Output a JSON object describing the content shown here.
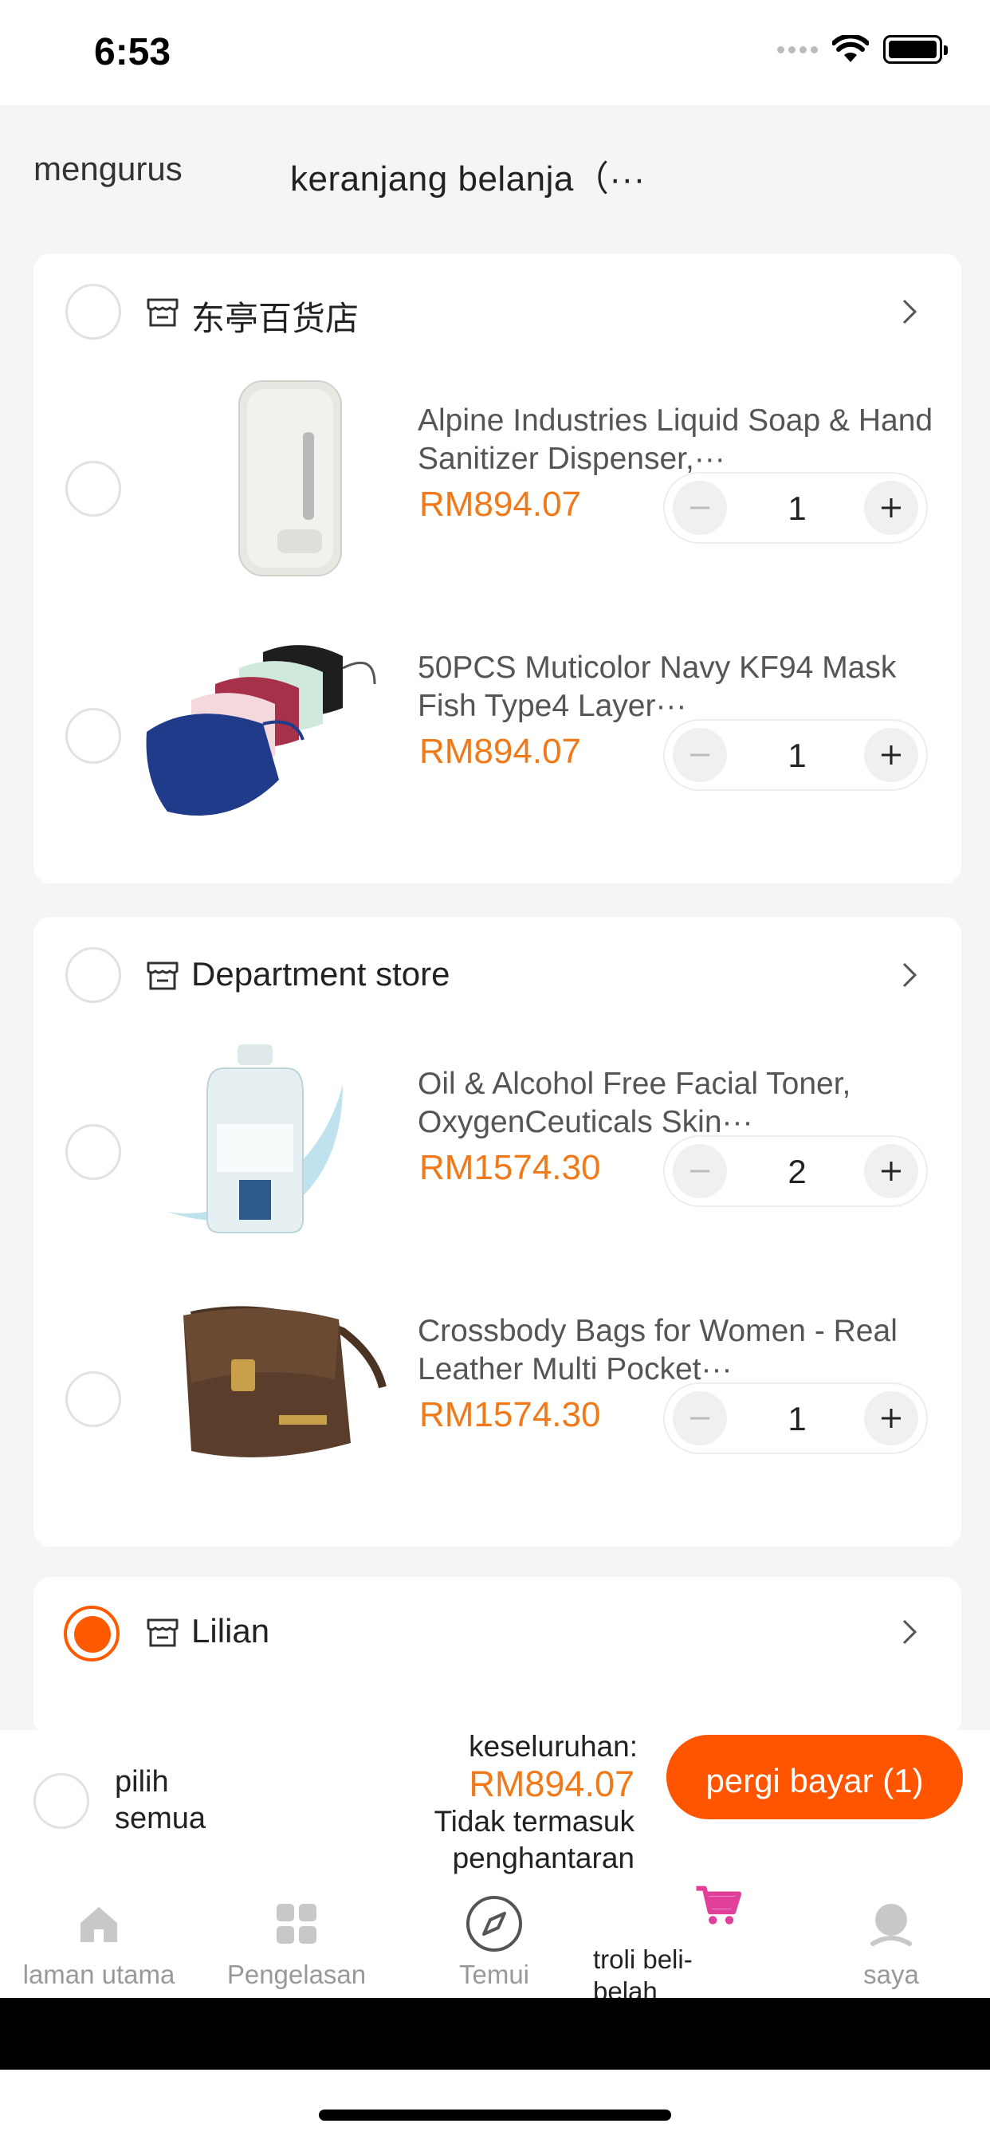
{
  "status_bar": {
    "time": "6:53"
  },
  "header": {
    "manage_label": "mengurus",
    "title": "keranjang belanja（···"
  },
  "stores": [
    {
      "name": "东亭百货店",
      "selected": false,
      "products": [
        {
          "title": "Alpine Industries Liquid Soap & Hand Sanitizer Dispenser,···",
          "price": "RM894.07",
          "quantity": "1",
          "image": "soap-dispenser"
        },
        {
          "title": "50PCS Muticolor Navy KF94 Mask Fish Type4 Layer···",
          "price": "RM894.07",
          "quantity": "1",
          "image": "face-masks"
        }
      ]
    },
    {
      "name": "Department store",
      "selected": false,
      "products": [
        {
          "title": "Oil & Alcohol Free Facial Toner, OxygenCeuticals Skin···",
          "price": "RM1574.30",
          "quantity": "2",
          "image": "toner-bottle"
        },
        {
          "title": "Crossbody Bags for Women - Real Leather Multi Pocket···",
          "price": "RM1574.30",
          "quantity": "1",
          "image": "leather-bag"
        }
      ]
    },
    {
      "name": "Lilian",
      "selected": true,
      "products": []
    }
  ],
  "bottom_bar": {
    "select_all_label": "pilih semua",
    "total_label": "keseluruhan:",
    "total_value": "RM894.07",
    "total_note": "Tidak termasuk penghantaran",
    "checkout_label": "pergi bayar (1)"
  },
  "tabs": [
    {
      "label": "laman utama",
      "icon": "home-icon",
      "active": false
    },
    {
      "label": "Pengelasan",
      "icon": "grid-icon",
      "active": false
    },
    {
      "label": "Temui",
      "icon": "compass-icon",
      "active": false
    },
    {
      "label": "troli beli-belah",
      "icon": "cart-icon",
      "active": true
    },
    {
      "label": "saya",
      "icon": "profile-icon",
      "active": false
    }
  ],
  "colors": {
    "accent": "#ff5500",
    "price": "#f07a1a",
    "cart_active": "#e0409a",
    "background": "#f5f5f5"
  }
}
